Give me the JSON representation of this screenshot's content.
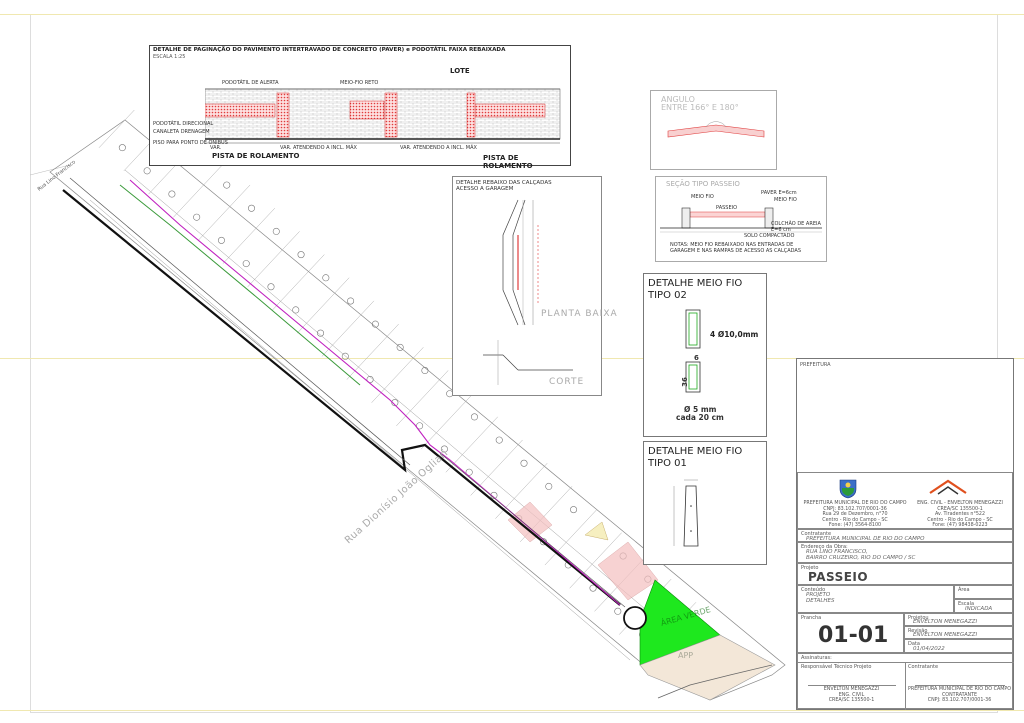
{
  "paver_detail": {
    "title": "DETALHE DE PAGINAÇÃO DO PAVIMENTO INTERTRAVADO DE CONCRETO (PAVER) e PODOTÁTIL FAIXA REBAIXADA",
    "scale": "ESCALA 1:25",
    "lote": "LOTE",
    "pista_left": "PISTA DE ROLAMENTO",
    "pista_right": "PISTA DE ROLAMENTO",
    "annotations": [
      "PODOTÁTIL DE ALERTA",
      "PODOTÁTIL DIRECIONAL",
      "CANALETA DRENAGEM",
      "PISO PARA PONTO DE ÔNIBUS",
      "MEIO-FIO RETO"
    ],
    "dim_labels": [
      "VAR. ATENDENDO A INCL. MÁX",
      "VAR. ATENDENDO A INCL. MÁX",
      "VAR."
    ]
  },
  "angle_detail": {
    "title_line1": "ANGULO",
    "title_line2": "ENTRE 166° E 180°"
  },
  "section_detail": {
    "title": "SEÇÃO TIPO PASSEIO",
    "labels": [
      "PAVER E=6cm",
      "MEIO FIO",
      "MEIO FIO",
      "PASSEIO",
      "COLCHÃO DE AREIA E=6 cm",
      "SOLO COMPACTADO"
    ],
    "note": "NOTAS: MEIO FIO REBAIXADO NAS ENTRADAS DE GARAGEM E NAS RAMPAS DE ACESSO AS CALÇADAS"
  },
  "rebaixo_detail": {
    "title_line1": "DETALHE REBAIXO DAS CALÇADAS",
    "title_line2": "ACESSO A GARAGEM",
    "planta": "PLANTA BAIXA",
    "corte": "CORTE"
  },
  "meio_fio_02": {
    "title_line1": "DETALHE MEIO FIO",
    "title_line2": "TIPO 02",
    "rebar": "4 Ø10,0mm",
    "dim_top": "6",
    "dim_side": "36",
    "stirrup_line1": "Ø 5 mm",
    "stirrup_line2": "cada 20 cm"
  },
  "meio_fio_01": {
    "title_line1": "DETALHE MEIO FIO",
    "title_line2": "TIPO 01"
  },
  "site_plan": {
    "street_1": "Rua Lino Francisco",
    "street_2": "Rua Dionísio João Ogliari",
    "area_verde": "ÁREA VERDE",
    "app": "APP"
  },
  "title_block": {
    "prefeitura_header": "PREFEITURA",
    "left_org": [
      "PREFEITURA MUNICIPAL DE RIO DO CAMPO",
      "CNPJ: 83.102.707/0001-36",
      "Rua 29 de Dezembro, n°70",
      "Centro - Rio do Campo - SC",
      "Fone: (47) 3564-8100"
    ],
    "right_org": [
      "ENG. CIVIL - ENVELTON MENEGAZZI",
      "CREA/SC 135500-1",
      "Av. Tiradentes n°522",
      "Centro - Rio do Campo - SC",
      "Fone: (47) 98438-0223"
    ],
    "contratante_label": "Contratante",
    "contratante_value": "PREFEITURA MUNICIPAL DE RIO DO CAMPO",
    "endereco_label": "Endereço da Obra:",
    "endereco_line1": "RUA LINO FRANCISCO,",
    "endereco_line2": "BAIRRO CRUZEIRO, RIO DO CAMPO / SC",
    "projeto_label": "Projeto",
    "projeto_value": "PASSEIO",
    "conteudo_label": "Conteúdo",
    "conteudo_line1": "PROJETO",
    "conteudo_line2": "DETALHES",
    "area_label": "Área",
    "escala_label": "Escala",
    "escala_value": "INDICADA",
    "prancha_label": "Prancha",
    "prancha_value": "01-01",
    "projetou_label": "Projetou",
    "projetou_value": "ENVELTON MENEGAZZI",
    "revisao_label": "Revisão",
    "revisao_value": "ENVELTON MENEGAZZI",
    "data_label": "Data",
    "data_value": "01/04/2022",
    "assinaturas_label": "Assinaturas:",
    "resp_label": "Responsável Técnico Projeto",
    "resp_line1": "ENVELTON MENEGAZZI",
    "resp_line2": "ENG. CIVIL",
    "resp_line3": "CREA/SC 135500-1",
    "contr_label": "Contratante",
    "contr_line1": "PREFEITURA MUNICIPAL DE RIO DO CAMPO",
    "contr_line2": "CONTRATANTE",
    "contr_line3": "CNPJ: 83.102.707/0001-36"
  },
  "colors": {
    "area_verde": "#1ee81e",
    "paver_red": "#e03c3c",
    "path_magenta": "#c020c0",
    "path_green": "#3a9a3a",
    "logo_orange": "#e0501e"
  }
}
